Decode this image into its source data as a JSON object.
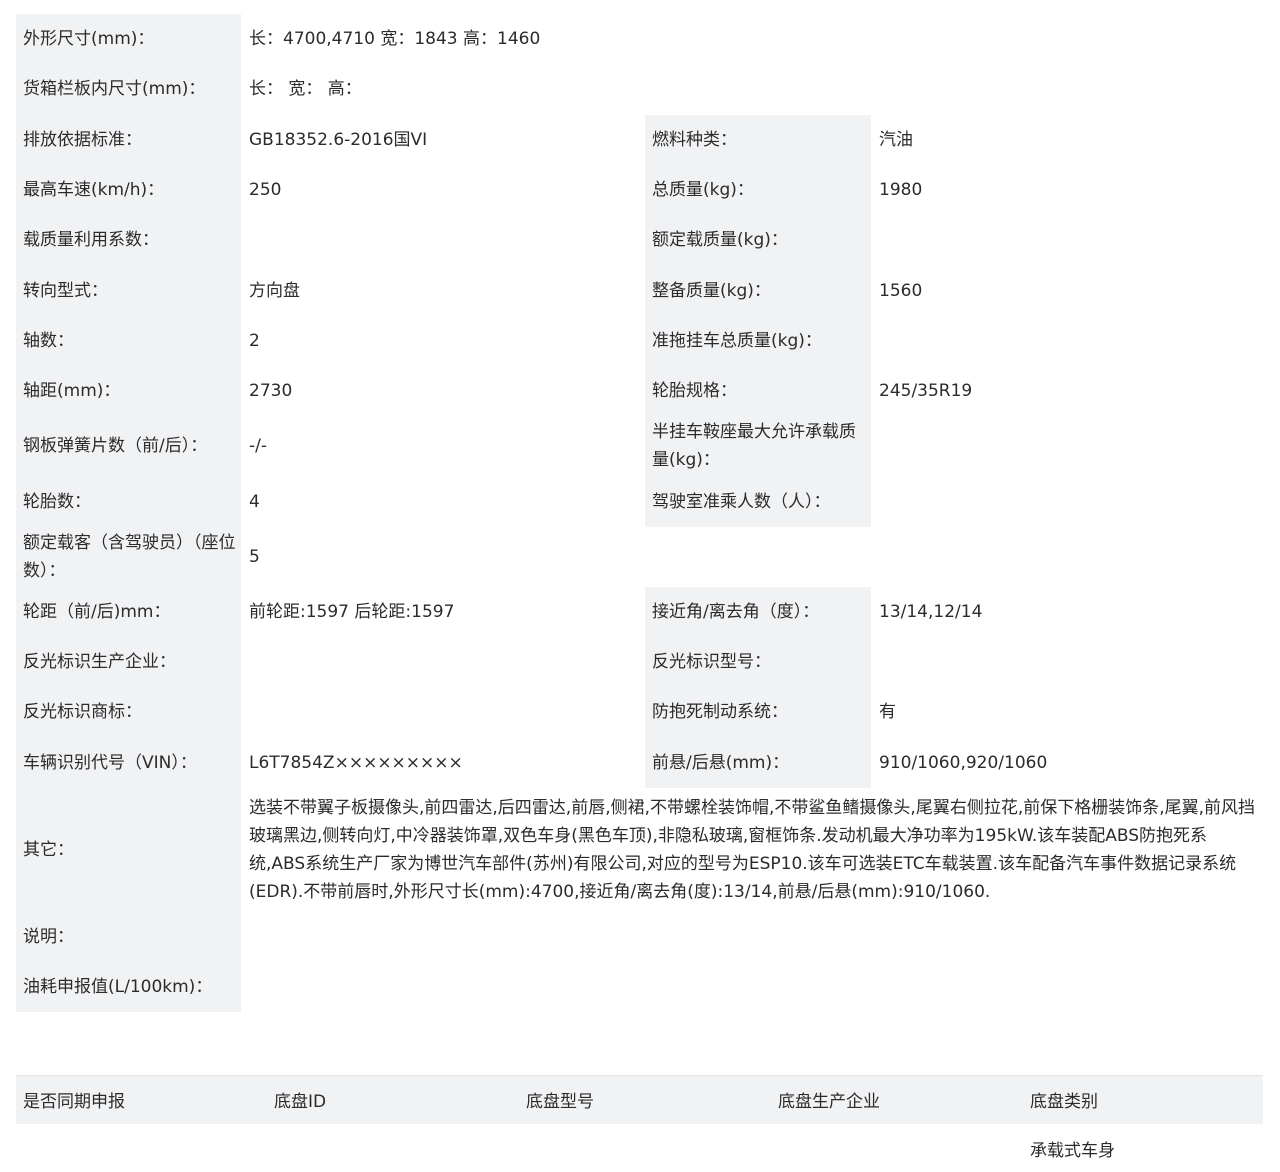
{
  "rows": {
    "dims": {
      "label": "外形尺寸(mm)：",
      "value": "长：4700,4710 宽：1843 高：1460"
    },
    "cargo": {
      "label": "货箱栏板内尺寸(mm)：",
      "value": "长： 宽： 高："
    },
    "emission": {
      "label": "排放依据标准：",
      "value": "GB18352.6-2016国VI",
      "label2": "燃料种类：",
      "value2": "汽油"
    },
    "speed": {
      "label": "最高车速(km/h)：",
      "value": "250",
      "label2": "总质量(kg)：",
      "value2": "1980"
    },
    "load_coef": {
      "label": "载质量利用系数：",
      "value": "",
      "label2": "额定载质量(kg)：",
      "value2": ""
    },
    "steering": {
      "label": "转向型式：",
      "value": "方向盘",
      "label2": "整备质量(kg)：",
      "value2": "1560"
    },
    "axles": {
      "label": "轴数：",
      "value": "2",
      "label2": "准拖挂车总质量(kg)：",
      "value2": ""
    },
    "wheelbase": {
      "label": "轴距(mm)：",
      "value": "2730",
      "label2": "轮胎规格：",
      "value2": "245/35R19"
    },
    "springs": {
      "label": "钢板弹簧片数（前/后）：",
      "value": "-/-",
      "label2": "半挂车鞍座最大允许承载质量(kg)：",
      "value2": ""
    },
    "tires": {
      "label": "轮胎数：",
      "value": "4",
      "label2": "驾驶室准乘人数（人）：",
      "value2": ""
    },
    "seats": {
      "label": "额定载客（含驾驶员）（座位数）：",
      "value": "5"
    },
    "track": {
      "label": "轮距（前/后)mm：",
      "value": "前轮距:1597 后轮距:1597",
      "label2": "接近角/离去角（度）：",
      "value2": "13/14,12/14"
    },
    "reflect_maker": {
      "label": "反光标识生产企业：",
      "value": "",
      "label2": "反光标识型号：",
      "value2": ""
    },
    "reflect_brand": {
      "label": "反光标识商标：",
      "value": "",
      "label2": "防抱死制动系统：",
      "value2": "有"
    },
    "vin": {
      "label": "车辆识别代号（VIN）：",
      "value": "L6T7854Z×××××××××",
      "label2": "前悬/后悬(mm)：",
      "value2": "910/1060,920/1060"
    },
    "other": {
      "label": "其它：",
      "value": "选装不带翼子板摄像头,前四雷达,后四雷达,前唇,侧裙,不带螺栓装饰帽,不带鲨鱼鳍摄像头,尾翼右侧拉花,前保下格栅装饰条,尾翼,前风挡玻璃黑边,侧转向灯,中冷器装饰罩,双色车身(黑色车顶),非隐私玻璃,窗框饰条.发动机最大净功率为195kW.该车装配ABS防抱死系统,ABS系统生产厂家为博世汽车部件(苏州)有限公司,对应的型号为ESP10.该车可选装ETC车载装置.该车配备汽车事件数据记录系统(EDR).不带前唇时,外形尺寸长(mm):4700,接近角/离去角(度):13/14,前悬/后悬(mm):910/1060."
    },
    "note": {
      "label": "说明：",
      "value": ""
    },
    "fuel": {
      "label": "油耗申报值(L/100km)：",
      "value": ""
    }
  },
  "chassis": {
    "headers": [
      "是否同期申报",
      "底盘ID",
      "底盘型号",
      "底盘生产企业",
      "底盘类别"
    ],
    "row": [
      "",
      "",
      "",
      "",
      "承载式车身"
    ]
  }
}
